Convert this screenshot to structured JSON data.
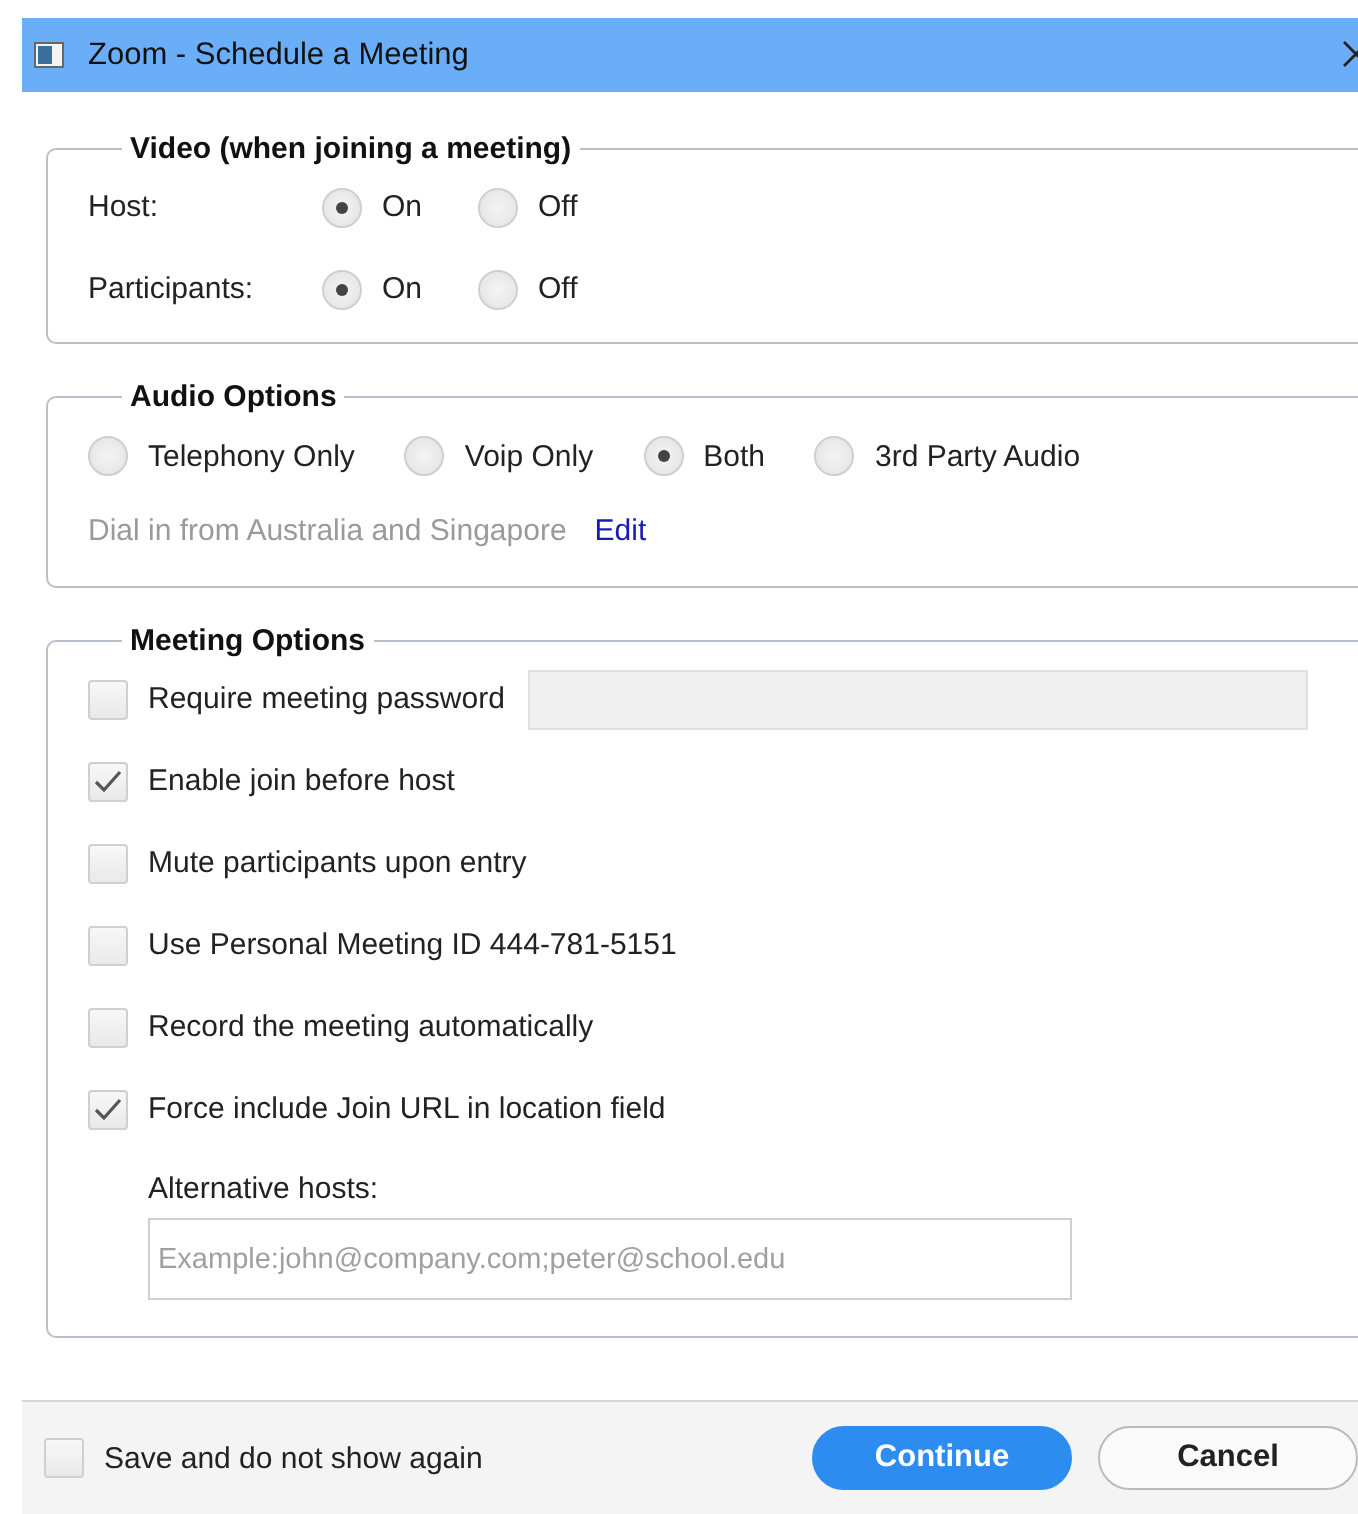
{
  "window": {
    "title": "Zoom - Schedule a Meeting"
  },
  "video": {
    "legend": "Video (when joining a meeting)",
    "rows": [
      {
        "label": "Host:",
        "options": [
          {
            "label": "On",
            "selected": true
          },
          {
            "label": "Off",
            "selected": false
          }
        ]
      },
      {
        "label": "Participants:",
        "options": [
          {
            "label": "On",
            "selected": true
          },
          {
            "label": "Off",
            "selected": false
          }
        ]
      }
    ]
  },
  "audio": {
    "legend": "Audio Options",
    "options": [
      {
        "label": "Telephony Only",
        "selected": false
      },
      {
        "label": "Voip Only",
        "selected": false
      },
      {
        "label": "Both",
        "selected": true
      },
      {
        "label": "3rd Party Audio",
        "selected": false
      }
    ],
    "dial_in": "Dial in from Australia and Singapore",
    "edit_link": "Edit"
  },
  "meeting_options": {
    "legend": "Meeting Options",
    "items": [
      {
        "label": "Require meeting password",
        "checked": false,
        "kind": "password"
      },
      {
        "label": "Enable join before host",
        "checked": true,
        "kind": "plain"
      },
      {
        "label": "Mute participants upon entry",
        "checked": false,
        "kind": "plain"
      },
      {
        "label": "Use Personal Meeting ID 444-781-5151",
        "checked": false,
        "kind": "plain"
      },
      {
        "label": "Record the meeting automatically",
        "checked": false,
        "kind": "plain"
      },
      {
        "label": "Force include Join URL in location field",
        "checked": true,
        "kind": "plain"
      }
    ],
    "alternative_hosts": {
      "label": "Alternative hosts:",
      "placeholder": "Example:john@company.com;peter@school.edu"
    }
  },
  "footer": {
    "save": {
      "label": "Save and do not show again",
      "checked": false
    },
    "buttons": [
      {
        "label": "Continue",
        "kind": "primary"
      },
      {
        "label": "Cancel",
        "kind": "secondary"
      }
    ]
  }
}
